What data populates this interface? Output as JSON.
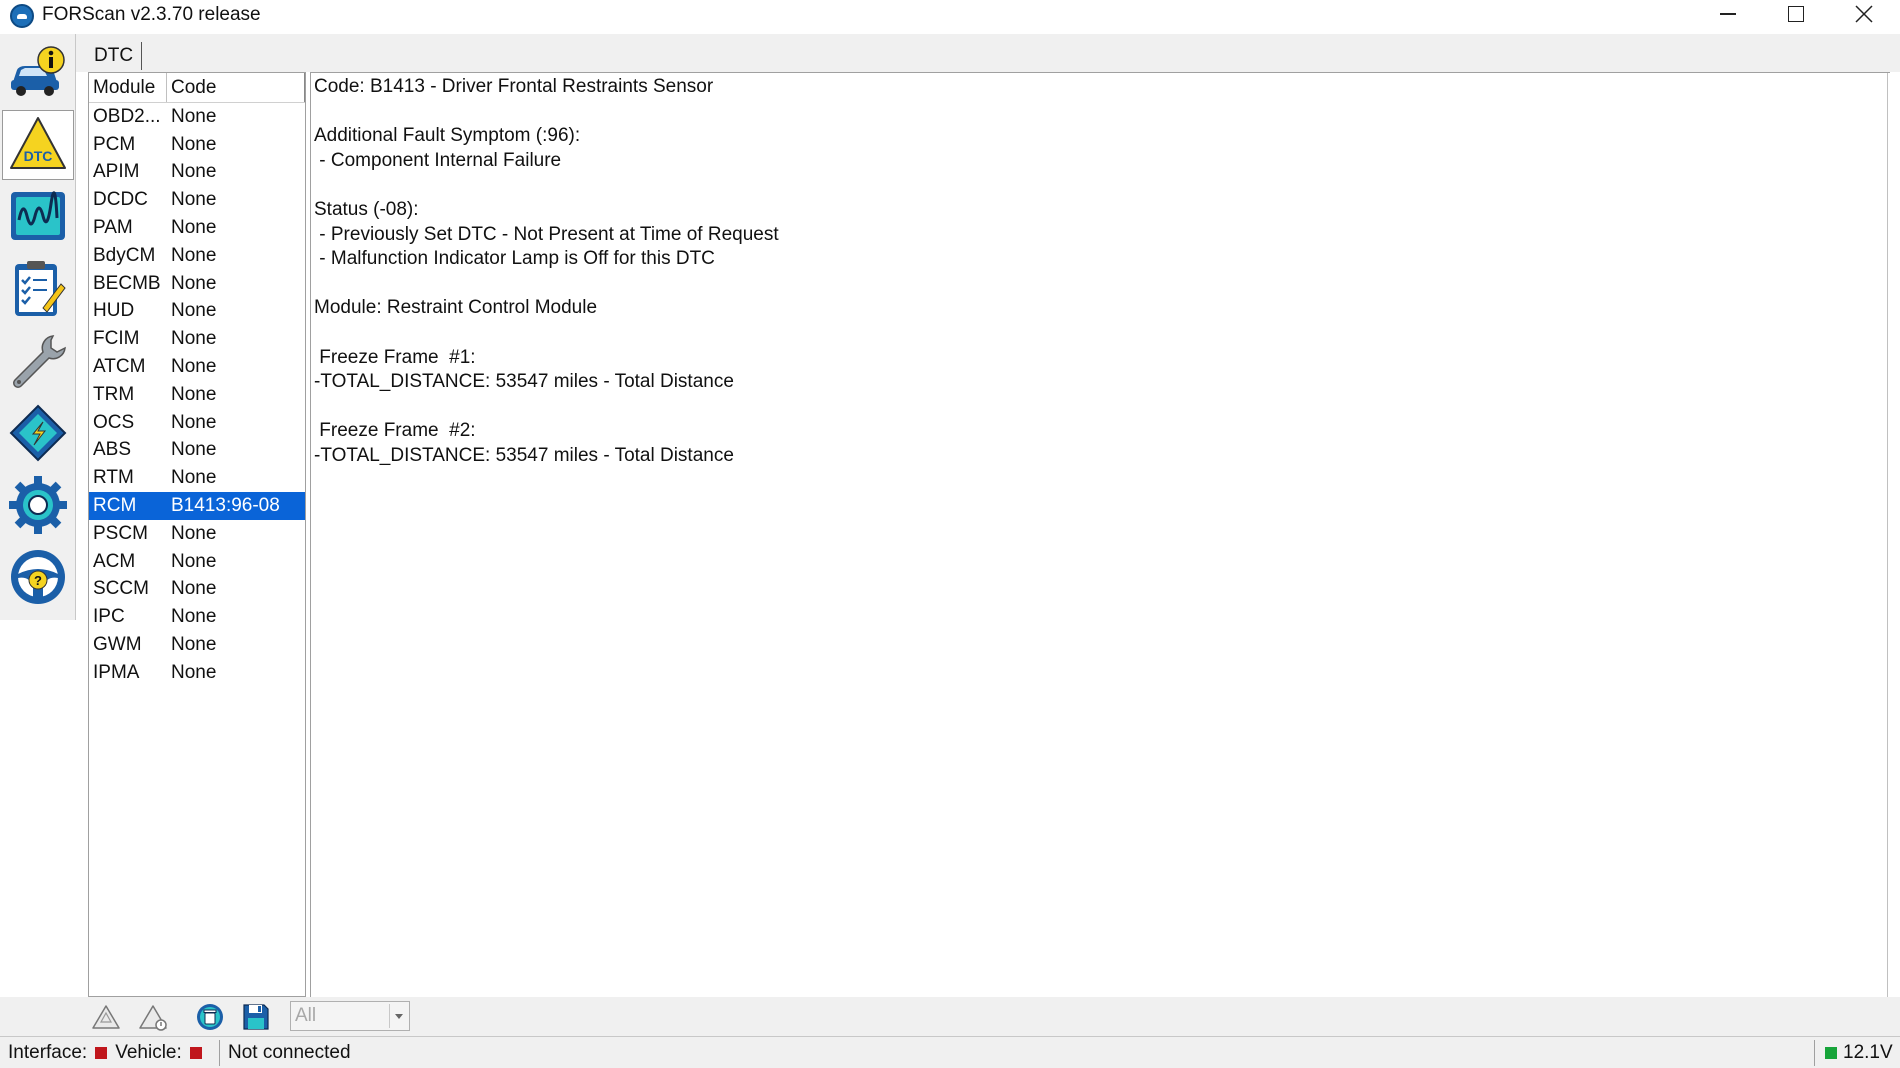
{
  "window": {
    "title": "FORScan v2.3.70 release"
  },
  "tabs": {
    "active_label": "DTC"
  },
  "sidebar": {
    "items": [
      {
        "name": "vehicle-info",
        "icon": "car-info-icon"
      },
      {
        "name": "dtc",
        "icon": "dtc-warning-icon",
        "active": true
      },
      {
        "name": "oscilloscope",
        "icon": "oscilloscope-icon"
      },
      {
        "name": "tests",
        "icon": "checklist-icon"
      },
      {
        "name": "service",
        "icon": "wrench-icon"
      },
      {
        "name": "configuration",
        "icon": "chip-icon"
      },
      {
        "name": "settings",
        "icon": "gear-icon"
      },
      {
        "name": "help",
        "icon": "steering-wheel-help-icon"
      }
    ]
  },
  "module_list": {
    "headers": {
      "module": "Module",
      "code": "Code"
    },
    "rows": [
      {
        "module": "OBD2...",
        "code": "None"
      },
      {
        "module": "PCM",
        "code": "None"
      },
      {
        "module": "APIM",
        "code": "None"
      },
      {
        "module": "DCDC",
        "code": "None"
      },
      {
        "module": "PAM",
        "code": "None"
      },
      {
        "module": "BdyCM",
        "code": "None"
      },
      {
        "module": "BECMB",
        "code": "None"
      },
      {
        "module": "HUD",
        "code": "None"
      },
      {
        "module": "FCIM",
        "code": "None"
      },
      {
        "module": "ATCM",
        "code": "None"
      },
      {
        "module": "TRM",
        "code": "None"
      },
      {
        "module": "OCS",
        "code": "None"
      },
      {
        "module": "ABS",
        "code": "None"
      },
      {
        "module": "RTM",
        "code": "None"
      },
      {
        "module": "RCM",
        "code": "B1413:96-08",
        "selected": true
      },
      {
        "module": "PSCM",
        "code": "None"
      },
      {
        "module": "ACM",
        "code": "None"
      },
      {
        "module": "SCCM",
        "code": "None"
      },
      {
        "module": "IPC",
        "code": "None"
      },
      {
        "module": "GWM",
        "code": "None"
      },
      {
        "module": "IPMA",
        "code": "None"
      }
    ]
  },
  "detail": {
    "lines": [
      "Code: B1413 - Driver Frontal Restraints Sensor",
      "",
      "Additional Fault Symptom (:96):",
      " - Component Internal Failure",
      "",
      "Status (-08):",
      " - Previously Set DTC - Not Present at Time of Request",
      " - Malfunction Indicator Lamp is Off for this DTC",
      "",
      "Module: Restraint Control Module",
      "",
      " Freeze Frame  #1:",
      "-TOTAL_DISTANCE: 53547 miles - Total Distance",
      "",
      " Freeze Frame  #2:",
      "-TOTAL_DISTANCE: 53547 miles - Total Distance"
    ]
  },
  "toolbar": {
    "buttons": [
      {
        "name": "read-dtc",
        "icon": "warning-read-icon"
      },
      {
        "name": "read-dtc-details",
        "icon": "warning-details-icon"
      },
      {
        "name": "clear-dtc",
        "icon": "trash-icon"
      },
      {
        "name": "save",
        "icon": "floppy-disk-icon"
      }
    ],
    "filter_value": "All"
  },
  "statusbar": {
    "interface_label": "Interface:",
    "vehicle_label": "Vehicle:",
    "connection_text": "Not connected",
    "voltage": "12.1V",
    "colors": {
      "disconnected": "#c0161c",
      "voltage_ok": "#17a43a"
    }
  }
}
